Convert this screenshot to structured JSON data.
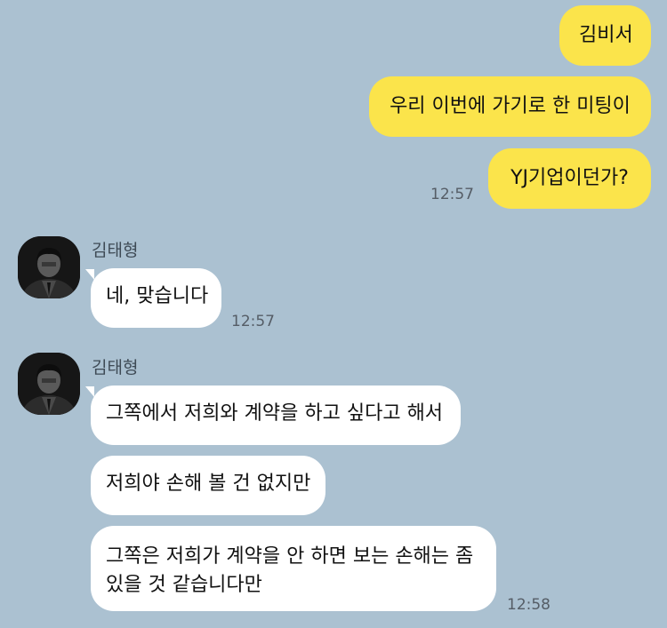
{
  "outgoing": [
    {
      "text": "김비서"
    },
    {
      "text": "우리 이번에 가기로 한 미팅이"
    },
    {
      "text": "YJ기업이던가?"
    }
  ],
  "outgoing_time": "12:57",
  "incoming_group_1": {
    "sender": "김태형",
    "messages": [
      {
        "text": "네, 맞습니다"
      }
    ],
    "time": "12:57"
  },
  "incoming_group_2": {
    "sender": "김태형",
    "messages": [
      {
        "text": "그쪽에서 저희와 계약을 하고 싶다고 해서"
      },
      {
        "text": "저희야 손해 볼 건 없지만"
      },
      {
        "text": "그쪽은 저희가 계약을 안 하면 보는 손해는 좀 있을 것 같습니다만"
      }
    ],
    "time": "12:58"
  },
  "colors": {
    "background": "#abc1d1",
    "outgoing_bubble": "#fbe44b",
    "incoming_bubble": "#ffffff"
  },
  "icons": {
    "avatar": "profile-photo-avatar"
  }
}
